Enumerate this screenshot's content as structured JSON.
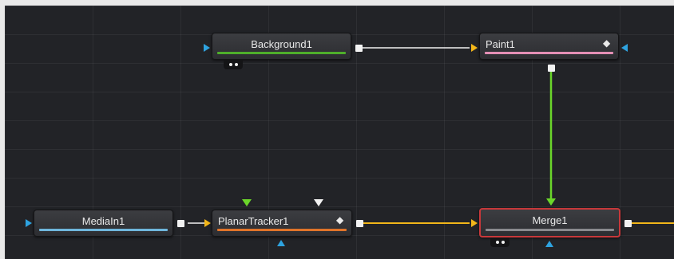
{
  "colors": {
    "canvas_bg": "#222327",
    "wire_white": "#f2f2f2",
    "wire_yellow": "#f2b619",
    "wire_green": "#6bd62a",
    "port_blue": "#2ea3e0",
    "selected_border": "#c8383a"
  },
  "nodes": {
    "background": {
      "label": "Background1",
      "bar_color": "#4fae2b"
    },
    "paint": {
      "label": "Paint1",
      "bar_color": "#e48fb5",
      "icon": "diamond-icon"
    },
    "mediain": {
      "label": "MediaIn1",
      "bar_color": "#6fb6dc"
    },
    "planartracker": {
      "label": "PlanarTracker1",
      "bar_color": "#e0742a",
      "icon": "diamond-icon"
    },
    "merge": {
      "label": "Merge1",
      "bar_color": "#8a8a8e",
      "selected": true
    }
  },
  "icons": {
    "diamond": "◆"
  }
}
